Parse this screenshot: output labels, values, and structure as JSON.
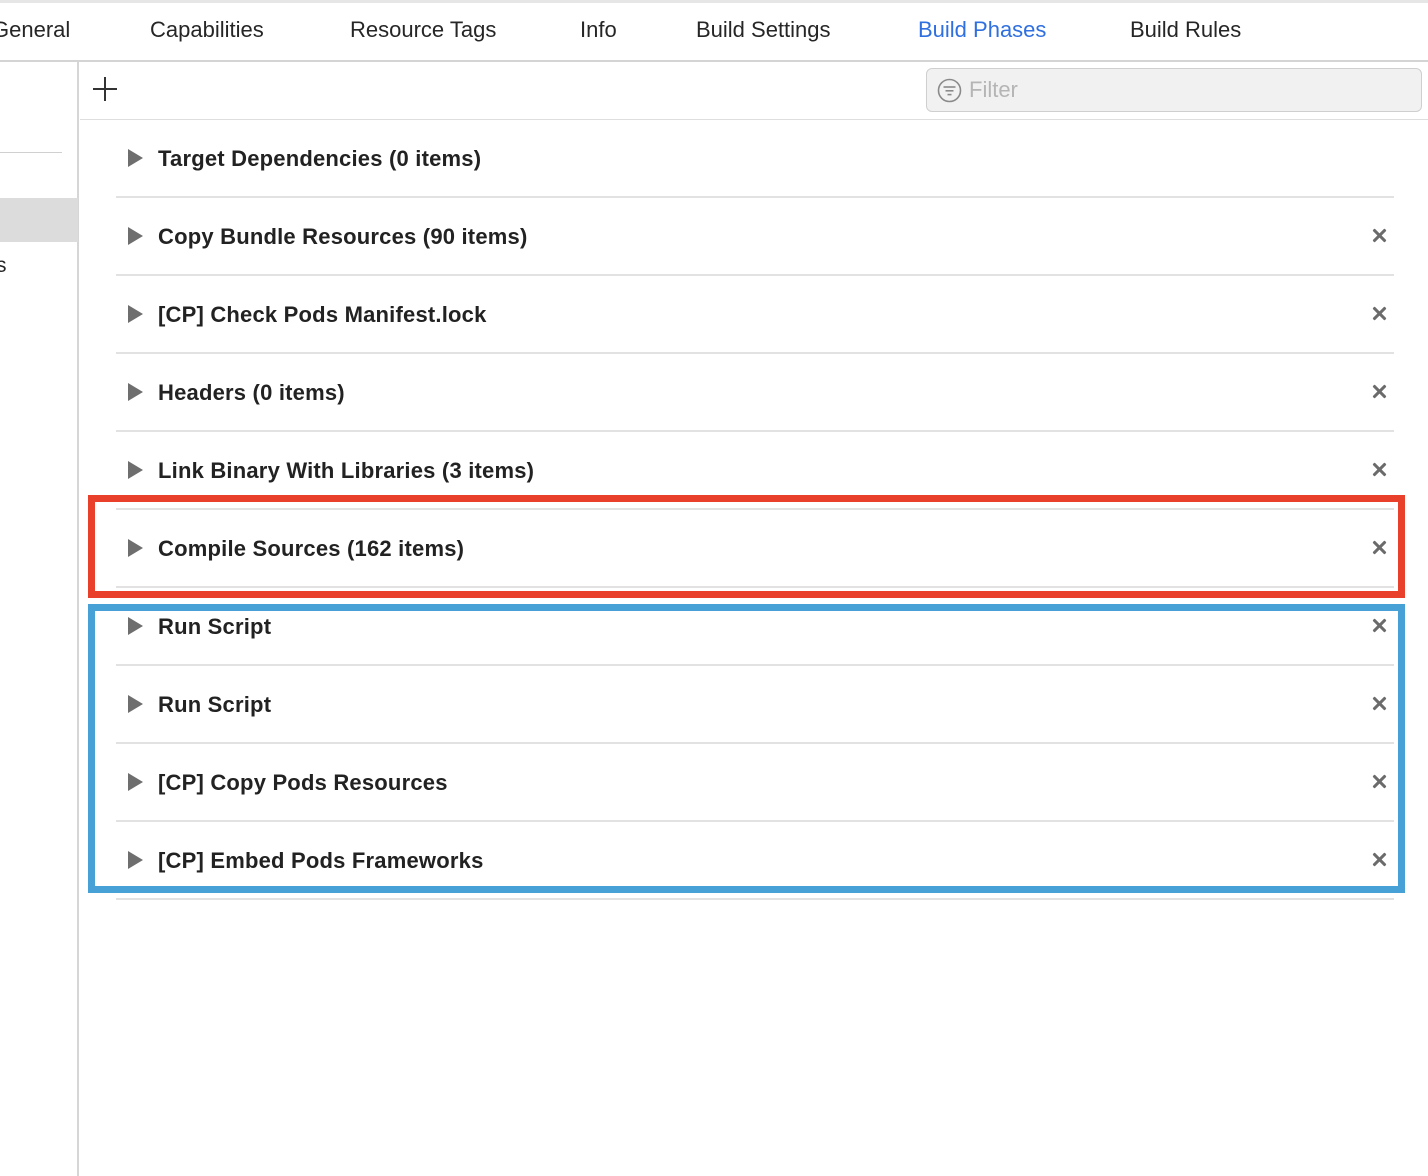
{
  "tabs": [
    {
      "label": "General",
      "active": false
    },
    {
      "label": "Capabilities",
      "active": false
    },
    {
      "label": "Resource Tags",
      "active": false
    },
    {
      "label": "Info",
      "active": false
    },
    {
      "label": "Build Settings",
      "active": false
    },
    {
      "label": "Build Phases",
      "active": true
    },
    {
      "label": "Build Rules",
      "active": false
    }
  ],
  "sidebar": {
    "fragment": "s"
  },
  "toolbar": {
    "add_icon": "plus-icon",
    "filter": {
      "icon": "filter-icon",
      "placeholder": "Filter",
      "value": ""
    }
  },
  "phases": [
    {
      "label": "Target Dependencies (0 items)",
      "removable": false
    },
    {
      "label": "Copy Bundle Resources (90 items)",
      "removable": true
    },
    {
      "label": "[CP] Check Pods Manifest.lock",
      "removable": true
    },
    {
      "label": "Headers (0 items)",
      "removable": true
    },
    {
      "label": "Link Binary With Libraries (3 items)",
      "removable": true
    },
    {
      "label": "Compile Sources (162 items)",
      "removable": true
    },
    {
      "label": "Run Script",
      "removable": true
    },
    {
      "label": "Run Script",
      "removable": true
    },
    {
      "label": "[CP] Copy Pods Resources",
      "removable": true
    },
    {
      "label": "[CP] Embed Pods Frameworks",
      "removable": true
    }
  ],
  "colors": {
    "active_tab": "#2f6fe0",
    "highlight_red": "#e8402a",
    "highlight_blue": "#47a1d6"
  }
}
